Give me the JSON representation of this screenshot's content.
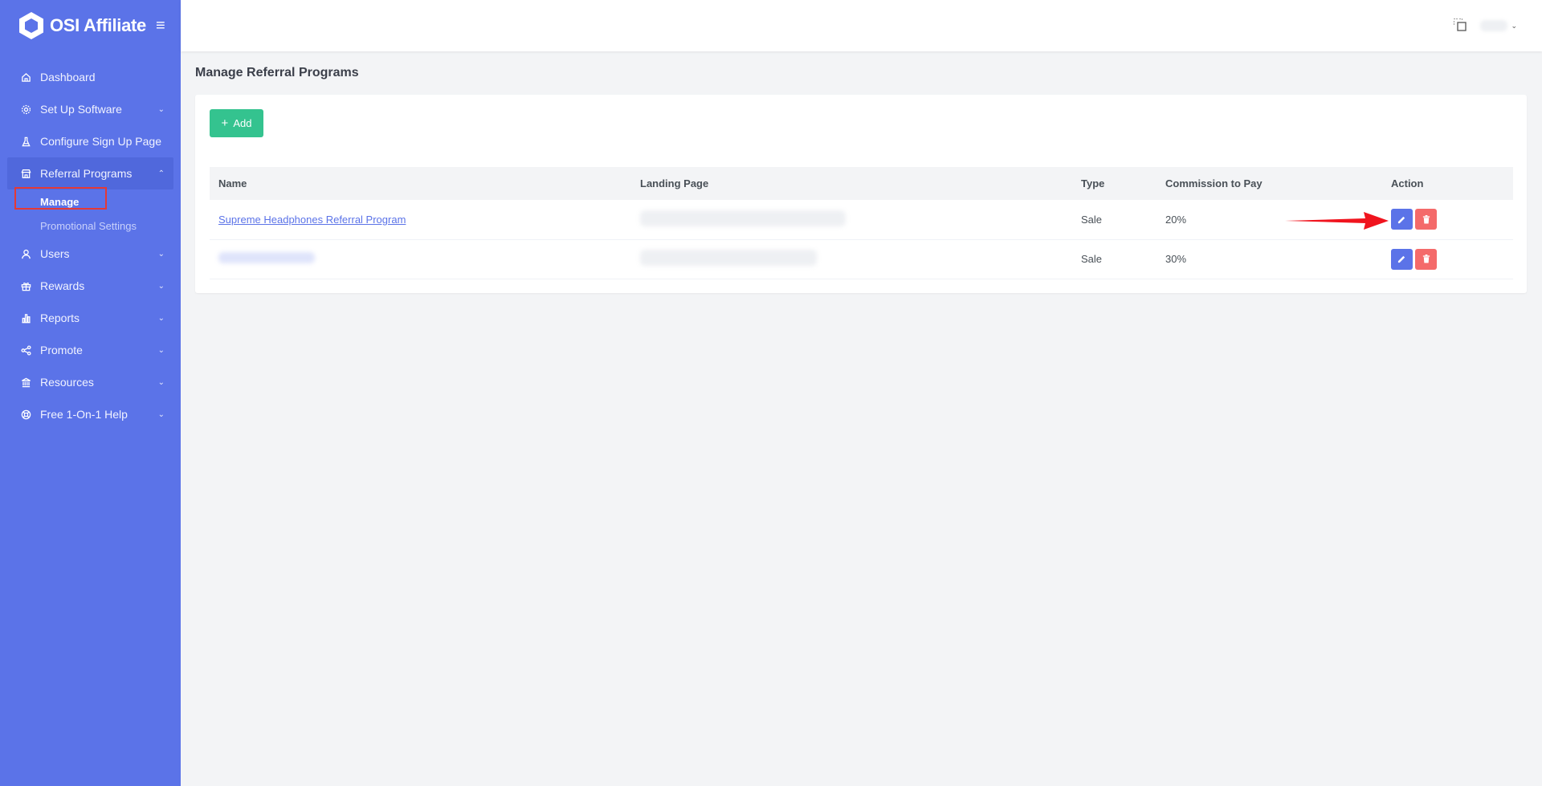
{
  "brand": {
    "name": "OSI Affiliate"
  },
  "sidebar": {
    "items": [
      {
        "label": "Dashboard",
        "icon": "home-icon",
        "has_chevron": false
      },
      {
        "label": "Set Up Software",
        "icon": "gear-icon",
        "has_chevron": true
      },
      {
        "label": "Configure Sign Up Page",
        "icon": "flask-icon",
        "has_chevron": false
      },
      {
        "label": "Referral Programs",
        "icon": "store-icon",
        "has_chevron": true,
        "expanded": true,
        "children": [
          {
            "label": "Manage",
            "current": true
          },
          {
            "label": "Promotional Settings",
            "current": false
          }
        ]
      },
      {
        "label": "Users",
        "icon": "user-icon",
        "has_chevron": true
      },
      {
        "label": "Rewards",
        "icon": "gift-icon",
        "has_chevron": true
      },
      {
        "label": "Reports",
        "icon": "bar-chart-icon",
        "has_chevron": true
      },
      {
        "label": "Promote",
        "icon": "share-icon",
        "has_chevron": true
      },
      {
        "label": "Resources",
        "icon": "bank-icon",
        "has_chevron": true
      },
      {
        "label": "Free 1-On-1 Help",
        "icon": "lifebuoy-icon",
        "has_chevron": true
      }
    ]
  },
  "main": {
    "title": "Manage Referral Programs",
    "add_label": "Add",
    "table": {
      "headers": [
        "Name",
        "Landing Page",
        "Type",
        "Commission to Pay",
        "Action"
      ],
      "rows": [
        {
          "name": "Supreme Headphones Referral Program",
          "type": "Sale",
          "commission": "20%"
        },
        {
          "name": "",
          "type": "Sale",
          "commission": "30%"
        }
      ]
    }
  },
  "colors": {
    "sidebar_bg": "#5b73e8",
    "add_button": "#34c38f",
    "edit_button": "#5b73e8",
    "delete_button": "#f46a6a",
    "highlight": "#e53935"
  }
}
